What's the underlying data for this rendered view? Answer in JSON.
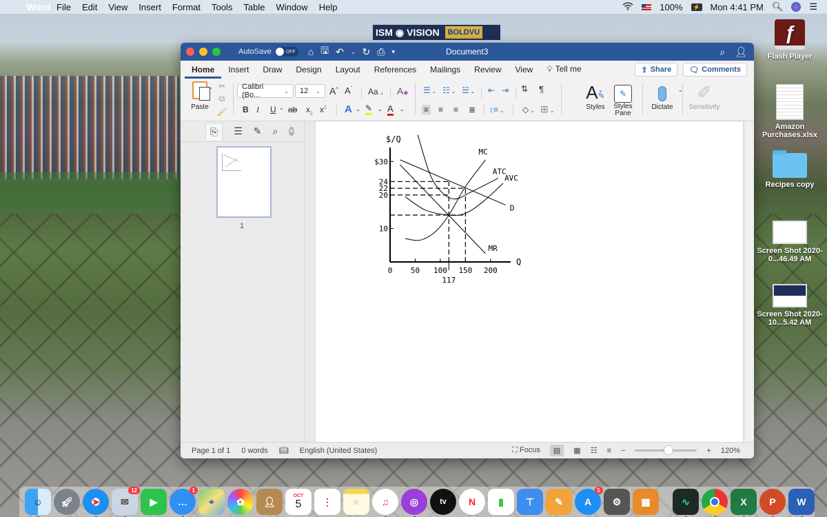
{
  "menubar": {
    "app_name": "Word",
    "items": [
      "File",
      "Edit",
      "View",
      "Insert",
      "Format",
      "Tools",
      "Table",
      "Window",
      "Help"
    ],
    "battery": "100%",
    "clock": "Mon 4:41 PM"
  },
  "background": {
    "sign_left": "ISM",
    "sign_right": "VISION",
    "sign_sponsor": "BOLDVU"
  },
  "window": {
    "autosave_label": "AutoSave",
    "autosave_state": "OFF",
    "title": "Document3",
    "tabs": [
      "Home",
      "Insert",
      "Draw",
      "Design",
      "Layout",
      "References",
      "Mailings",
      "Review",
      "View"
    ],
    "active_tab": "Home",
    "tell_me": "Tell me",
    "share_label": "Share",
    "comments_label": "Comments"
  },
  "ribbon": {
    "paste_label": "Paste",
    "font_name": "Calibri (Bo...",
    "font_size": "12",
    "styles_label": "Styles",
    "styles_pane_label": "Styles Pane",
    "dictate_label": "Dictate",
    "sensitivity_label": "Sensitivity",
    "case_label": "Aa"
  },
  "navigation": {
    "page_number": "1"
  },
  "status": {
    "page": "Page 1 of 1",
    "words": "0 words",
    "language": "English (United States)",
    "focus": "Focus",
    "zoom": "120%",
    "zoom_fraction": 0.55
  },
  "desktop_icons": [
    {
      "label": "Flash Player"
    },
    {
      "label": "Amazon Purchases.xlsx"
    },
    {
      "label": "Recipes copy"
    },
    {
      "label": "Screen Shot 2020-0...46.49 AM"
    },
    {
      "label": "Screen Shot 2020-10...5.42 AM"
    }
  ],
  "dock": {
    "badges": {
      "mail": "12",
      "messages": "1",
      "app_store": "5"
    },
    "calendar_month": "OCT",
    "calendar_day": "5",
    "tv_label": "tv"
  },
  "chart_data": {
    "type": "line",
    "title": "",
    "xlabel": "Q",
    "ylabel": "$/Q",
    "xlim": [
      0,
      240
    ],
    "ylim": [
      0,
      35
    ],
    "x_ticks": [
      "0",
      "50",
      "100",
      "150",
      "200"
    ],
    "x_tick_values": [
      0,
      50,
      100,
      150,
      200
    ],
    "x_special_tick": {
      "label": "117",
      "value": 117
    },
    "y_ticks": [
      "$30",
      "24",
      "22",
      "20",
      "10"
    ],
    "y_tick_values": [
      30,
      24,
      22,
      20,
      10
    ],
    "grid": false,
    "dashed_guides": [
      {
        "y": 24,
        "x_to": 117
      },
      {
        "y": 22,
        "x_to": 150
      },
      {
        "y": 20,
        "x_to": 117
      },
      {
        "y": 14,
        "x_to": 150
      },
      {
        "x": 117,
        "y_to": 24
      },
      {
        "x": 150,
        "y_to": 22
      }
    ],
    "series": [
      {
        "name": "D",
        "points": [
          [
            20,
            30.5
          ],
          [
            230,
            17
          ]
        ]
      },
      {
        "name": "MR",
        "points": [
          [
            20,
            29
          ],
          [
            190,
            2.5
          ]
        ]
      },
      {
        "name": "MC",
        "points": [
          [
            30,
            7
          ],
          [
            60,
            6.5
          ],
          [
            90,
            9
          ],
          [
            117,
            14
          ],
          [
            150,
            22.5
          ],
          [
            190,
            30.5
          ]
        ]
      },
      {
        "name": "ATC",
        "points": [
          [
            55,
            38
          ],
          [
            80,
            26
          ],
          [
            105,
            20.5
          ],
          [
            130,
            18.8
          ],
          [
            160,
            20.8
          ],
          [
            215,
            25
          ]
        ]
      },
      {
        "name": "AVC",
        "points": [
          [
            30,
            19.5
          ],
          [
            70,
            15.5
          ],
          [
            117,
            14
          ],
          [
            150,
            14.5
          ],
          [
            185,
            18
          ],
          [
            225,
            23.5
          ]
        ]
      }
    ],
    "curve_labels": [
      "MC",
      "ATC",
      "AVC",
      "D",
      "MR"
    ]
  }
}
